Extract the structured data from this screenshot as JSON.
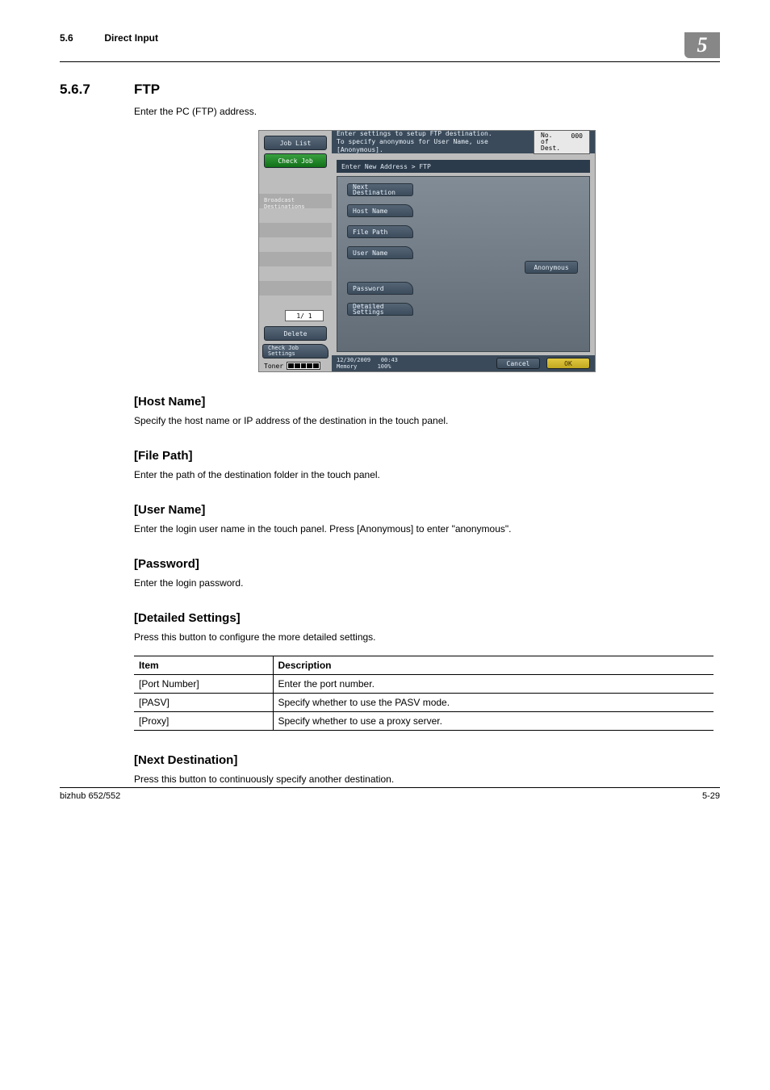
{
  "header": {
    "section_number": "5.6",
    "section_title": "Direct Input",
    "chapter": "5"
  },
  "h3": {
    "number": "5.6.7",
    "title": "FTP"
  },
  "intro": "Enter the PC (FTP) address.",
  "screenshot": {
    "left": {
      "job_list": "Job List",
      "check_job": "Check Job",
      "broadcast": "Broadcast\nDestinations",
      "page": "1/   1",
      "delete": "Delete",
      "check_job_settings": "Check Job\nSettings",
      "toner_label": "Toner"
    },
    "msg_line1": "Enter settings to setup FTP destination.",
    "msg_line2": "To specify anonymous for User Name, use [Anonymous].",
    "count_label": "No. of\nDest.",
    "count_value": "000",
    "breadcrumb": "Enter New Address > FTP",
    "buttons": {
      "next_destination": "Next\nDestination",
      "host_name": "Host Name",
      "file_path": "File Path",
      "user_name": "User Name",
      "anonymous": "Anonymous",
      "password": "Password",
      "detailed": "Detailed\nSettings"
    },
    "footer": {
      "date": "12/30/2009",
      "time": "00:43",
      "memory": "Memory",
      "memval": "100%",
      "cancel": "Cancel",
      "ok": "OK"
    }
  },
  "sections": {
    "host_name": {
      "title": "[Host Name]",
      "text": "Specify the host name or IP address of the destination in the touch panel."
    },
    "file_path": {
      "title": "[File Path]",
      "text": "Enter the path of the destination folder in the touch panel."
    },
    "user_name": {
      "title": "[User Name]",
      "text": "Enter the login user name in the touch panel. Press [Anonymous] to enter \"anonymous\"."
    },
    "password": {
      "title": "[Password]",
      "text": "Enter the login password."
    },
    "detailed": {
      "title": "[Detailed Settings]",
      "text": "Press this button to configure the more detailed settings."
    },
    "next_dest": {
      "title": "[Next Destination]",
      "text": "Press this button to continuously specify another destination."
    }
  },
  "table": {
    "head_item": "Item",
    "head_desc": "Description",
    "rows": [
      {
        "item": "[Port Number]",
        "desc": "Enter the port number."
      },
      {
        "item": "[PASV]",
        "desc": "Specify whether to use the PASV mode."
      },
      {
        "item": "[Proxy]",
        "desc": "Specify whether to use a proxy server."
      }
    ]
  },
  "footer": {
    "left": "bizhub 652/552",
    "right": "5-29"
  }
}
